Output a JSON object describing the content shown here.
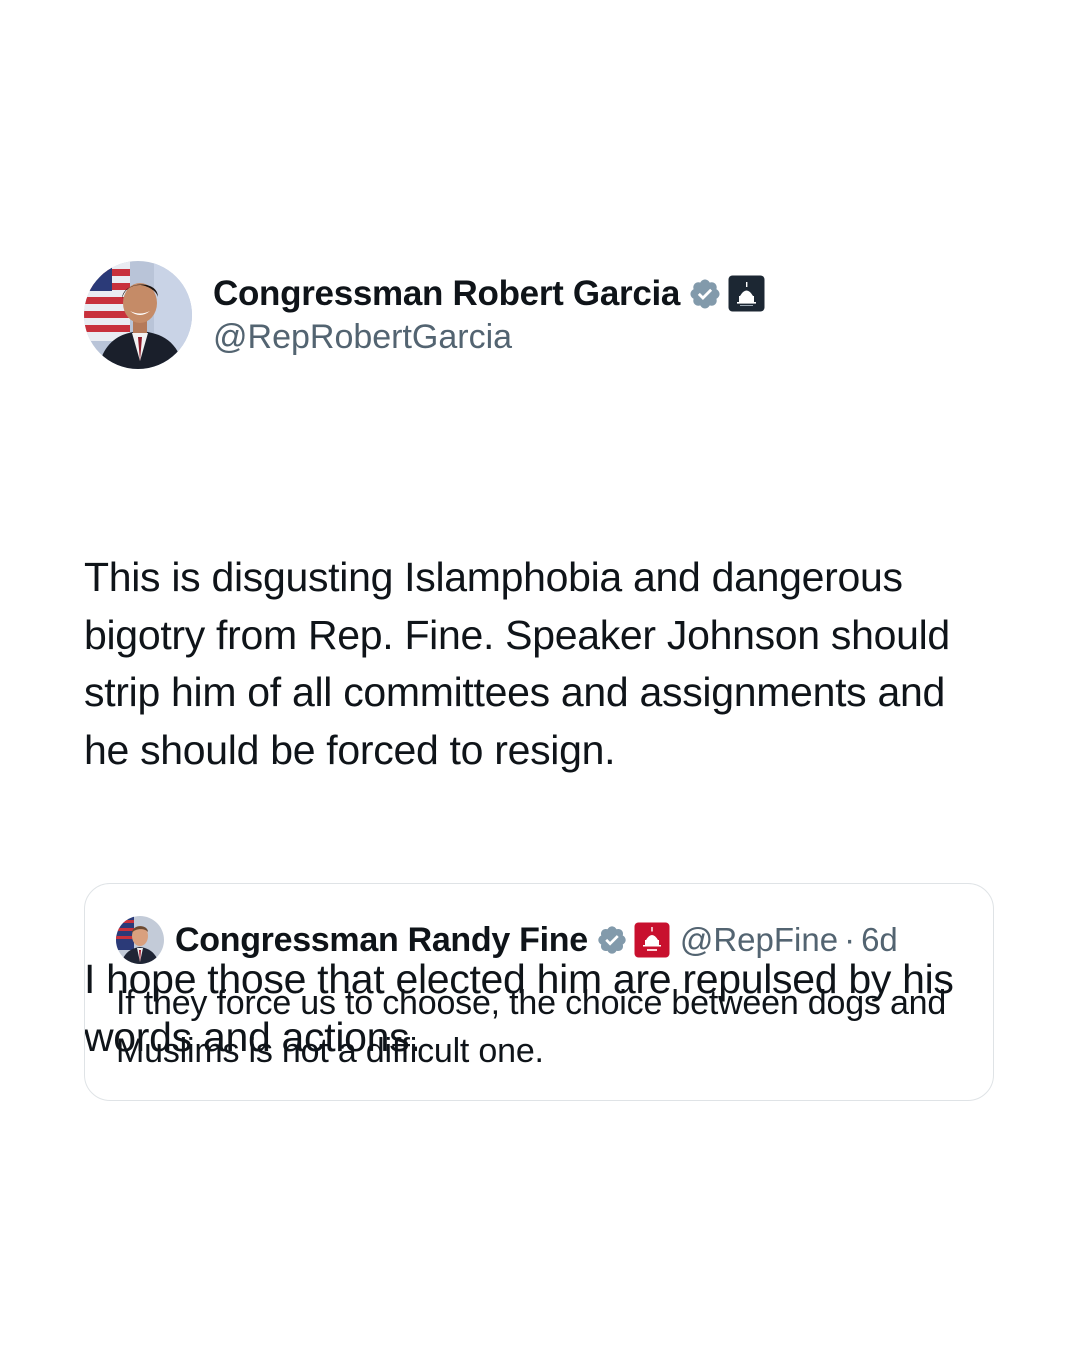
{
  "colors": {
    "verified": "#829aab",
    "govBadgeDark": "#1c2733",
    "govBadgeRed": "#c8102e",
    "secondaryText": "#536471",
    "border": "#dfe3e6"
  },
  "tweet": {
    "author": {
      "display_name": "Congressman Robert Garcia",
      "handle": "@RepRobertGarcia",
      "avatar_icon": "profile-photo-robert-garcia",
      "verified_icon": "verified-badge-icon",
      "affiliation_icon": "us-capitol-badge-icon"
    },
    "paragraphs": [
      "This is disgusting Islamphobia and dangerous bigotry from Rep. Fine. Speaker Johnson should strip him of all committees and assignments and he should be forced to resign.",
      "I hope those that elected him are repulsed by his words and actions."
    ]
  },
  "quoted_tweet": {
    "author": {
      "display_name": "Congressman Randy Fine",
      "handle": "@RepFine",
      "avatar_icon": "profile-photo-randy-fine",
      "verified_icon": "verified-badge-icon",
      "affiliation_icon": "gop-capitol-badge-icon"
    },
    "separator": "·",
    "timestamp": "6d",
    "text": "If they force us to choose, the choice between dogs and Muslims is not a difficult one."
  }
}
